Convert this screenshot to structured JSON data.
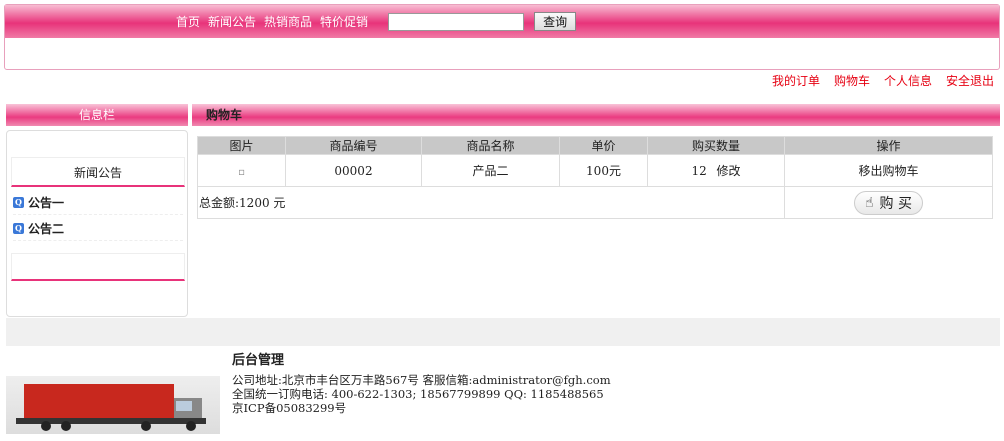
{
  "nav": {
    "items": [
      "首页",
      "新闻公告",
      "热销商品",
      "特价促销"
    ],
    "search_value": "",
    "search_button": "查询"
  },
  "user_links": [
    "我的订单",
    "购物车",
    "个人信息",
    "安全退出"
  ],
  "sidebar": {
    "title": "信息栏",
    "news_header": "新闻公告",
    "items": [
      "公告一",
      "公告二"
    ]
  },
  "main": {
    "title": "购物车",
    "columns": [
      "图片",
      "商品编号",
      "商品名称",
      "单价",
      "购买数量",
      "操作"
    ],
    "rows": [
      {
        "image_alt": "",
        "code": "00002",
        "name": "产品二",
        "price": "100元",
        "qty": "12",
        "edit": "修改",
        "action": "移出购物车"
      }
    ],
    "total": "总金额:1200 元",
    "buy_button": "购 买"
  },
  "footer": {
    "title": "后台管理",
    "address": "公司地址:北京市丰台区万丰路567号   客服信箱:administrator@fgh.com",
    "phone": "全国统一订购电话: 400-622-1303; 18567799899  QQ: 1185488565",
    "icp": "京ICP备05083299号"
  }
}
